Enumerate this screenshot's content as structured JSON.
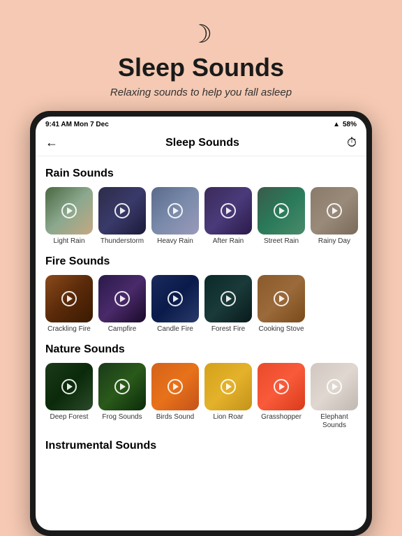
{
  "header": {
    "moon_icon": "☽",
    "title": "Sleep Sounds",
    "subtitle": "Relaxing sounds to help you fall asleep"
  },
  "status_bar": {
    "time": "9:41 AM",
    "date": "Mon 7 Dec",
    "signal": "58%"
  },
  "nav": {
    "back_icon": "←",
    "title": "Sleep Sounds",
    "timer_icon": "⏱"
  },
  "sections": [
    {
      "id": "rain",
      "title": "Rain Sounds",
      "items": [
        {
          "id": "light-rain",
          "label": "Light Rain",
          "thumb_class": "thumb-light-rain"
        },
        {
          "id": "thunderstorm",
          "label": "Thunderstorm",
          "thumb_class": "thumb-thunderstorm"
        },
        {
          "id": "heavy-rain",
          "label": "Heavy Rain",
          "thumb_class": "thumb-heavy-rain"
        },
        {
          "id": "after-rain",
          "label": "After Rain",
          "thumb_class": "thumb-after-rain"
        },
        {
          "id": "street-rain",
          "label": "Street Rain",
          "thumb_class": "thumb-street-rain"
        },
        {
          "id": "rainy-day",
          "label": "Rainy Day",
          "thumb_class": "thumb-rainy-day"
        }
      ]
    },
    {
      "id": "fire",
      "title": "Fire Sounds",
      "items": [
        {
          "id": "crackling-fire",
          "label": "Crackling Fire",
          "thumb_class": "thumb-crackling"
        },
        {
          "id": "campfire",
          "label": "Campfire",
          "thumb_class": "thumb-campfire"
        },
        {
          "id": "candle-fire",
          "label": "Candle Fire",
          "thumb_class": "thumb-candle"
        },
        {
          "id": "forest-fire",
          "label": "Forest Fire",
          "thumb_class": "thumb-forest-fire"
        },
        {
          "id": "cooking-stove",
          "label": "Cooking Stove",
          "thumb_class": "thumb-cooking"
        }
      ]
    },
    {
      "id": "nature",
      "title": "Nature Sounds",
      "items": [
        {
          "id": "deep-forest",
          "label": "Deep Forest",
          "thumb_class": "thumb-deep-forest"
        },
        {
          "id": "frog-sounds",
          "label": "Frog Sounds",
          "thumb_class": "thumb-frog"
        },
        {
          "id": "birds-sound",
          "label": "Birds Sound",
          "thumb_class": "thumb-birds"
        },
        {
          "id": "lion-roar",
          "label": "Lion Roar",
          "thumb_class": "thumb-lion"
        },
        {
          "id": "grasshopper",
          "label": "Grasshopper",
          "thumb_class": "thumb-grasshopper"
        },
        {
          "id": "elephant-sounds",
          "label": "Elephant Sounds",
          "thumb_class": "thumb-elephant"
        }
      ]
    },
    {
      "id": "instrumental",
      "title": "Instrumental Sounds",
      "items": []
    }
  ]
}
